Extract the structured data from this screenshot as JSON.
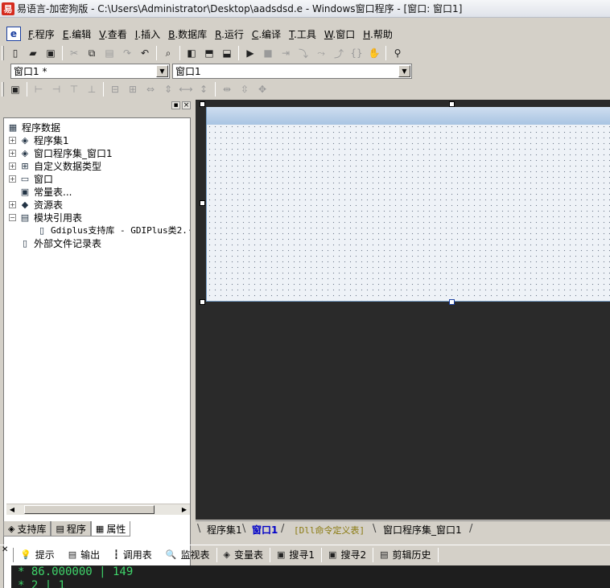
{
  "window": {
    "app_icon": "易",
    "title": "易语言-加密狗版 - C:\\Users\\Administrator\\Desktop\\aadsdsd.e - Windows窗口程序 - [窗口: 窗口1]"
  },
  "menu": {
    "logo_icon": "e-logo-icon",
    "items": [
      {
        "key": "F",
        "label": ".程序"
      },
      {
        "key": "E",
        "label": ".编辑"
      },
      {
        "key": "V",
        "label": ".查看"
      },
      {
        "key": "I",
        "label": ".插入"
      },
      {
        "key": "B",
        "label": ".数据库"
      },
      {
        "key": "R",
        "label": ".运行"
      },
      {
        "key": "C",
        "label": ".编译"
      },
      {
        "key": "T",
        "label": ".工具"
      },
      {
        "key": "W",
        "label": ".窗口"
      },
      {
        "key": "H",
        "label": ".帮助"
      }
    ]
  },
  "selectors": {
    "form_combo": "窗口1 *",
    "control_combo": "窗口1"
  },
  "left_panel": {
    "tree": [
      {
        "label": "程序数据",
        "expander": "",
        "icon": "▦",
        "level": 0
      },
      {
        "label": "程序集1",
        "expander": "+",
        "icon": "◈",
        "level": 1
      },
      {
        "label": "窗口程序集_窗口1",
        "expander": "+",
        "icon": "◈",
        "level": 1
      },
      {
        "label": "自定义数据类型",
        "expander": "+",
        "icon": "⊞",
        "level": 1
      },
      {
        "label": "窗口",
        "expander": "+",
        "icon": "▭",
        "level": 1
      },
      {
        "label": "常量表...",
        "expander": "",
        "icon": "▣",
        "level": 1
      },
      {
        "label": "资源表",
        "expander": "+",
        "icon": "◆",
        "level": 1
      },
      {
        "label": "模块引用表",
        "expander": "−",
        "icon": "▤",
        "level": 1
      },
      {
        "label": "Gdiplus支持库 - GDIPlus类2.·",
        "expander": "",
        "icon": "▯",
        "level": 2
      },
      {
        "label": "外部文件记录表",
        "expander": "",
        "icon": "▯",
        "level": 1
      }
    ],
    "tabs": [
      {
        "label": "支持库",
        "icon": "◈"
      },
      {
        "label": "程序",
        "icon": "▤"
      },
      {
        "label": "属性",
        "icon": "▦"
      }
    ]
  },
  "editor_tabs": [
    {
      "label": "程序集1"
    },
    {
      "label": "窗口1"
    },
    {
      "label": "[Dll命令定义表]"
    },
    {
      "label": "窗口程序集_窗口1"
    }
  ],
  "output_bar": {
    "buttons": [
      {
        "label": "提示",
        "icon": "💡"
      },
      {
        "label": "输出",
        "icon": "▤"
      },
      {
        "label": "调用表",
        "icon": "┇"
      },
      {
        "label": "监视表",
        "icon": "🔍"
      },
      {
        "label": "变量表",
        "icon": "◈"
      },
      {
        "label": "搜寻1",
        "icon": "▣"
      },
      {
        "label": "搜寻2",
        "icon": "▣"
      },
      {
        "label": "剪辑历史",
        "icon": "▤"
      }
    ],
    "console_lines": [
      "* 86.000000 | 149",
      "* 2 | 1"
    ]
  },
  "colors": {
    "design_background": "#2a2a2a",
    "form_caption": "#b7cde6",
    "console_text": "#3fd46a",
    "active_tab": "#0000c8"
  }
}
